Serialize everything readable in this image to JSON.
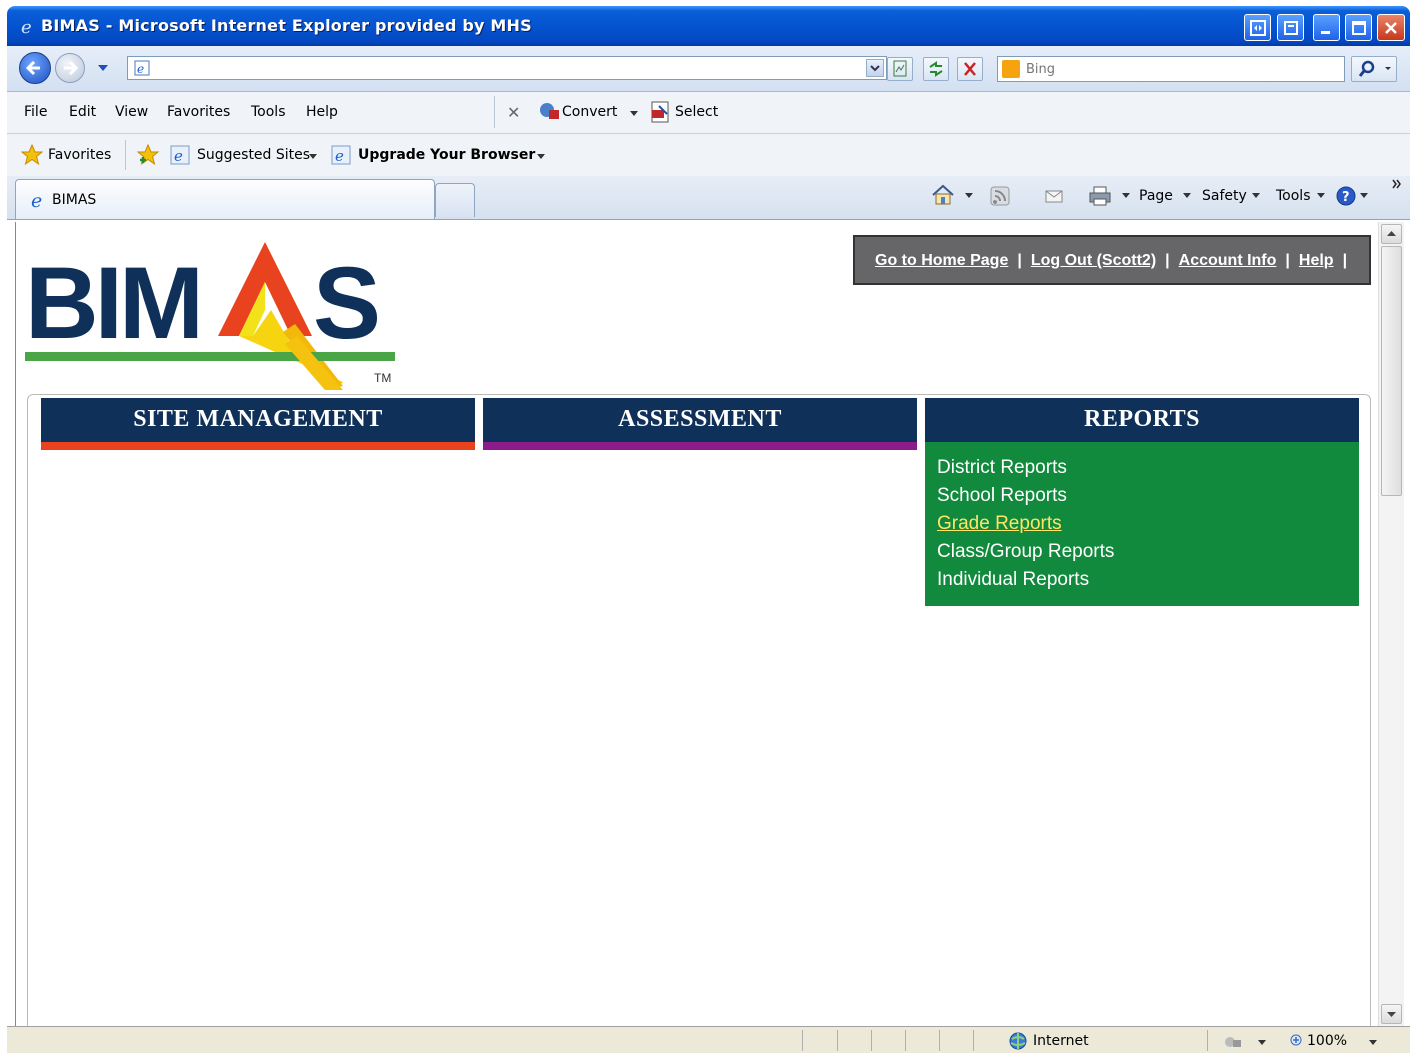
{
  "window": {
    "title": "BIMAS - Microsoft Internet Explorer provided by MHS"
  },
  "address_bar": {
    "url": "",
    "search_placeholder": "Bing"
  },
  "menu": {
    "items": [
      "File",
      "Edit",
      "View",
      "Favorites",
      "Tools",
      "Help"
    ],
    "convert_label": "Convert",
    "select_label": "Select"
  },
  "favorites_bar": {
    "favorites_label": "Favorites",
    "suggested_sites": "Suggested Sites",
    "upgrade_browser": "Upgrade Your Browser"
  },
  "tabs": {
    "active_tab_label": "BIMAS"
  },
  "command_bar": {
    "page": "Page",
    "safety": "Safety",
    "tools": "Tools"
  },
  "site": {
    "logo_text": "BIMAS",
    "logo_tm": "TM",
    "top_links": [
      "Go to Home Page",
      "Log Out (Scott2)",
      "Account Info",
      "Help"
    ],
    "sections": [
      {
        "label": "SITE MANAGEMENT",
        "bar_color": "#e8431e"
      },
      {
        "label": "ASSESSMENT",
        "bar_color": "#8b1d8a"
      },
      {
        "label": "REPORTS",
        "bar_color": "#118a3d"
      }
    ],
    "reports_menu": [
      "District Reports",
      "School Reports",
      "Grade Reports",
      "Class/Group Reports",
      "Individual Reports"
    ],
    "hovered_report": "Grade Reports"
  },
  "status_bar": {
    "zone": "Internet",
    "zoom": "100%"
  },
  "colors": {
    "navy": "#0f3159",
    "green": "#118a3d",
    "topnav_bg": "#666668"
  }
}
